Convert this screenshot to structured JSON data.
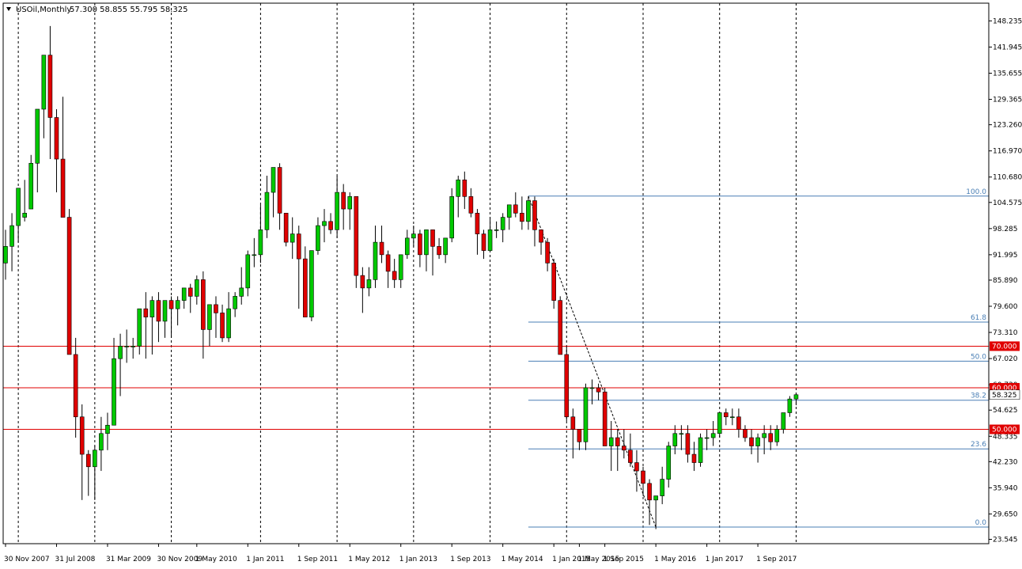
{
  "header": {
    "symbol": "USOil,Monthly",
    "ohlc": "57.300 58.855 55.795 58.325"
  },
  "colors": {
    "bull": "#00c800",
    "bear": "#e00000",
    "fib": "#4a7fb5",
    "hline": "#e00000",
    "grid": "#000000"
  },
  "chart_data": {
    "type": "candlestick",
    "title": "USOil,Monthly",
    "ylim": [
      22.5,
      152.5
    ],
    "y_ticks": [
      "148.235",
      "141.945",
      "135.655",
      "129.365",
      "123.260",
      "116.970",
      "110.680",
      "104.575",
      "98.285",
      "91.995",
      "85.890",
      "79.600",
      "73.310",
      "67.020",
      "60.730",
      "54.625",
      "48.335",
      "42.230",
      "35.940",
      "29.650",
      "23.545"
    ],
    "x_labels": [
      {
        "label": "30 Nov 2007",
        "bar": 0
      },
      {
        "label": "31 Jul 2008",
        "bar": 8
      },
      {
        "label": "31 Mar 2009",
        "bar": 16
      },
      {
        "label": "30 Nov 2009",
        "bar": 24
      },
      {
        "label": "1 May 2010",
        "bar": 30
      },
      {
        "label": "1 Jan 2011",
        "bar": 38
      },
      {
        "label": "1 Sep 2011",
        "bar": 46
      },
      {
        "label": "1 May 2012",
        "bar": 54
      },
      {
        "label": "1 Jan 2013",
        "bar": 62
      },
      {
        "label": "1 Sep 2013",
        "bar": 70
      },
      {
        "label": "1 May 2014",
        "bar": 78
      },
      {
        "label": "1 Jan 2015",
        "bar": 86
      },
      {
        "label": "1 May 2015",
        "bar": 90
      },
      {
        "label": "1 Sep 2015",
        "bar": 94
      },
      {
        "label": "1 May 2016",
        "bar": 102
      },
      {
        "label": "1 Jan 2017",
        "bar": 110
      },
      {
        "label": "1 Sep 2017",
        "bar": 118
      }
    ],
    "grid_bars": [
      2,
      14,
      26,
      40,
      52,
      64,
      76,
      88,
      100,
      112,
      124
    ],
    "candles": [
      [
        90.0,
        98.0,
        86.0,
        94.0
      ],
      [
        94.0,
        102.0,
        88.0,
        99.0
      ],
      [
        99.0,
        108.0,
        95.0,
        108.0
      ],
      [
        101.0,
        110.0,
        100.0,
        102.0
      ],
      [
        103.0,
        116.0,
        103.0,
        114.0
      ],
      [
        114.0,
        126.0,
        107.0,
        127.0
      ],
      [
        127.0,
        140.0,
        120.0,
        140.0
      ],
      [
        140.0,
        147.0,
        115.0,
        125.0
      ],
      [
        125.0,
        127.0,
        107.0,
        115.0
      ],
      [
        115.0,
        130.0,
        105.0,
        101.0
      ],
      [
        101.0,
        103.0,
        86.0,
        68.0
      ],
      [
        68.0,
        72.0,
        48.0,
        53.0
      ],
      [
        53.0,
        56.0,
        33.0,
        44.0
      ],
      [
        44.0,
        45.0,
        34.0,
        41.0
      ],
      [
        41.0,
        46.0,
        33.0,
        45.0
      ],
      [
        45.0,
        53.0,
        40.0,
        49.0
      ],
      [
        49.0,
        54.0,
        45.0,
        51.0
      ],
      [
        51.0,
        72.0,
        51.0,
        67.0
      ],
      [
        67.0,
        73.0,
        58.0,
        70.0
      ],
      [
        70.0,
        74.0,
        66.0,
        70.0
      ],
      [
        70.0,
        72.0,
        67.0,
        70.0
      ],
      [
        70.0,
        75.0,
        68.0,
        79.0
      ],
      [
        79.0,
        83.0,
        67.0,
        77.0
      ],
      [
        77.0,
        82.0,
        68.0,
        81.0
      ],
      [
        81.0,
        83.0,
        71.0,
        76.0
      ],
      [
        76.0,
        80.0,
        72.0,
        81.0
      ],
      [
        81.0,
        82.0,
        72.0,
        79.0
      ],
      [
        79.0,
        82.0,
        75.0,
        81.0
      ],
      [
        81.0,
        84.0,
        79.0,
        84.0
      ],
      [
        84.0,
        85.0,
        78.0,
        82.0
      ],
      [
        82.0,
        87.0,
        80.0,
        86.0
      ],
      [
        86.0,
        88.0,
        67.0,
        74.0
      ],
      [
        74.0,
        78.0,
        70.0,
        80.0
      ],
      [
        80.0,
        82.0,
        72.0,
        78.0
      ],
      [
        78.0,
        80.0,
        71.0,
        72.0
      ],
      [
        72.0,
        83.0,
        71.0,
        79.0
      ],
      [
        79.0,
        83.0,
        77.0,
        82.0
      ],
      [
        82.0,
        89.0,
        80.0,
        84.0
      ],
      [
        84.0,
        93.0,
        82.0,
        92.0
      ],
      [
        92.0,
        96.0,
        89.0,
        92.0
      ],
      [
        92.0,
        104.0,
        90.0,
        98.0
      ],
      [
        98.0,
        111.0,
        96.0,
        107.0
      ],
      [
        107.0,
        113.0,
        101.0,
        113.0
      ],
      [
        113.0,
        114.0,
        98.0,
        102.0
      ],
      [
        102.0,
        102.0,
        94.0,
        95.0
      ],
      [
        95.0,
        101.0,
        91.0,
        97.0
      ],
      [
        97.0,
        99.0,
        79.0,
        91.0
      ],
      [
        91.0,
        94.0,
        77.0,
        77.0
      ],
      [
        77.0,
        93.0,
        76.0,
        93.0
      ],
      [
        93.0,
        101.0,
        92.0,
        99.0
      ],
      [
        99.0,
        103.0,
        95.0,
        100.0
      ],
      [
        100.0,
        102.0,
        97.0,
        98.0
      ],
      [
        98.0,
        111.0,
        96.0,
        107.0
      ],
      [
        107.0,
        109.0,
        98.0,
        103.0
      ],
      [
        103.0,
        107.0,
        98.0,
        106.0
      ],
      [
        106.0,
        106.0,
        84.0,
        87.0
      ],
      [
        87.0,
        89.0,
        78.0,
        84.0
      ],
      [
        84.0,
        89.0,
        82.0,
        86.0
      ],
      [
        86.0,
        99.0,
        84.0,
        95.0
      ],
      [
        95.0,
        99.0,
        90.0,
        92.0
      ],
      [
        92.0,
        93.0,
        84.0,
        88.0
      ],
      [
        88.0,
        91.0,
        84.0,
        86.0
      ],
      [
        86.0,
        92.0,
        84.0,
        92.0
      ],
      [
        92.0,
        98.0,
        91.0,
        96.0
      ],
      [
        96.0,
        99.0,
        94.0,
        97.0
      ],
      [
        97.0,
        98.0,
        89.0,
        92.0
      ],
      [
        92.0,
        97.0,
        88.0,
        98.0
      ],
      [
        98.0,
        98.0,
        87.0,
        94.0
      ],
      [
        94.0,
        96.0,
        91.0,
        92.0
      ],
      [
        92.0,
        96.0,
        90.0,
        96.0
      ],
      [
        96.0,
        108.0,
        95.0,
        106.0
      ],
      [
        106.0,
        111.0,
        101.0,
        110.0
      ],
      [
        110.0,
        112.0,
        103.0,
        106.0
      ],
      [
        106.0,
        108.0,
        101.0,
        102.0
      ],
      [
        102.0,
        103.0,
        92.0,
        97.0
      ],
      [
        97.0,
        98.0,
        91.0,
        93.0
      ],
      [
        93.0,
        101.0,
        94.0,
        98.0
      ],
      [
        98.0,
        100.0,
        96.0,
        98.0
      ],
      [
        98.0,
        102.0,
        95.0,
        101.0
      ],
      [
        101.0,
        104.0,
        98.0,
        104.0
      ],
      [
        104.0,
        107.0,
        101.0,
        102.0
      ],
      [
        102.0,
        106.0,
        98.0,
        100.0
      ],
      [
        100.0,
        106.0,
        98.0,
        105.0
      ],
      [
        105.0,
        106.0,
        94.0,
        98.0
      ],
      [
        98.0,
        98.0,
        92.0,
        95.0
      ],
      [
        95.0,
        96.0,
        88.0,
        90.0
      ],
      [
        90.0,
        91.0,
        79.0,
        81.0
      ],
      [
        81.0,
        82.0,
        68.0,
        68.0
      ],
      [
        68.0,
        70.0,
        52.0,
        53.0
      ],
      [
        53.0,
        55.0,
        43.0,
        50.0
      ],
      [
        50.0,
        50.0,
        45.0,
        47.0
      ],
      [
        47.0,
        61.0,
        45.0,
        60.0
      ],
      [
        60.0,
        62.0,
        56.0,
        60.0
      ],
      [
        60.0,
        61.0,
        57.0,
        59.0
      ],
      [
        59.0,
        60.0,
        46.0,
        46.0
      ],
      [
        46.0,
        52.0,
        40.0,
        48.0
      ],
      [
        48.0,
        50.0,
        40.0,
        46.0
      ],
      [
        46.0,
        50.0,
        43.0,
        45.0
      ],
      [
        45.0,
        49.0,
        41.0,
        42.0
      ],
      [
        42.0,
        45.0,
        35.0,
        40.0
      ],
      [
        40.0,
        41.0,
        34.0,
        37.0
      ],
      [
        37.0,
        38.0,
        27.0,
        33.0
      ],
      [
        33.0,
        34.0,
        26.0,
        34.0
      ],
      [
        34.0,
        41.0,
        32.0,
        38.0
      ],
      [
        38.0,
        47.0,
        36.0,
        46.0
      ],
      [
        46.0,
        51.0,
        44.0,
        49.0
      ],
      [
        49.0,
        51.0,
        45.0,
        49.0
      ],
      [
        49.0,
        51.0,
        42.0,
        44.0
      ],
      [
        44.0,
        47.0,
        40.0,
        42.0
      ],
      [
        42.0,
        49.0,
        41.0,
        48.0
      ],
      [
        48.0,
        50.0,
        45.0,
        48.0
      ],
      [
        48.0,
        52.0,
        46.0,
        49.0
      ],
      [
        49.0,
        54.0,
        48.0,
        54.0
      ],
      [
        54.0,
        55.0,
        51.0,
        53.0
      ],
      [
        53.0,
        55.0,
        51.0,
        53.0
      ],
      [
        53.0,
        55.0,
        48.0,
        50.0
      ],
      [
        50.0,
        51.0,
        47.0,
        48.0
      ],
      [
        48.0,
        50.0,
        44.0,
        46.0
      ],
      [
        46.0,
        49.0,
        42.0,
        48.0
      ],
      [
        48.0,
        51.0,
        44.0,
        49.0
      ],
      [
        49.0,
        51.0,
        45.0,
        47.0
      ],
      [
        47.0,
        51.0,
        46.0,
        50.0
      ],
      [
        50.0,
        54.0,
        49.0,
        54.0
      ],
      [
        54.0,
        58.0,
        53.0,
        57.3
      ],
      [
        57.3,
        58.855,
        55.795,
        58.325
      ]
    ],
    "fib_levels": [
      {
        "label": "100.0",
        "value": 106.1
      },
      {
        "label": "61.8",
        "value": 75.8
      },
      {
        "label": "50.0",
        "value": 66.4
      },
      {
        "label": "38.2",
        "value": 57.0
      },
      {
        "label": "23.6",
        "value": 45.3
      },
      {
        "label": "0.0",
        "value": 26.5
      }
    ],
    "fib_start_bar": 82,
    "horizontal_lines": [
      {
        "label": "70.000",
        "value": 70.0
      },
      {
        "label": "60.000",
        "value": 60.0
      },
      {
        "label": "50.000",
        "value": 50.0
      }
    ],
    "current_price": {
      "label": "58.325",
      "value": 58.325
    },
    "trendline": {
      "from_bar": 82,
      "from_value": 106.1,
      "to_bar": 102,
      "to_value": 26.5
    }
  }
}
